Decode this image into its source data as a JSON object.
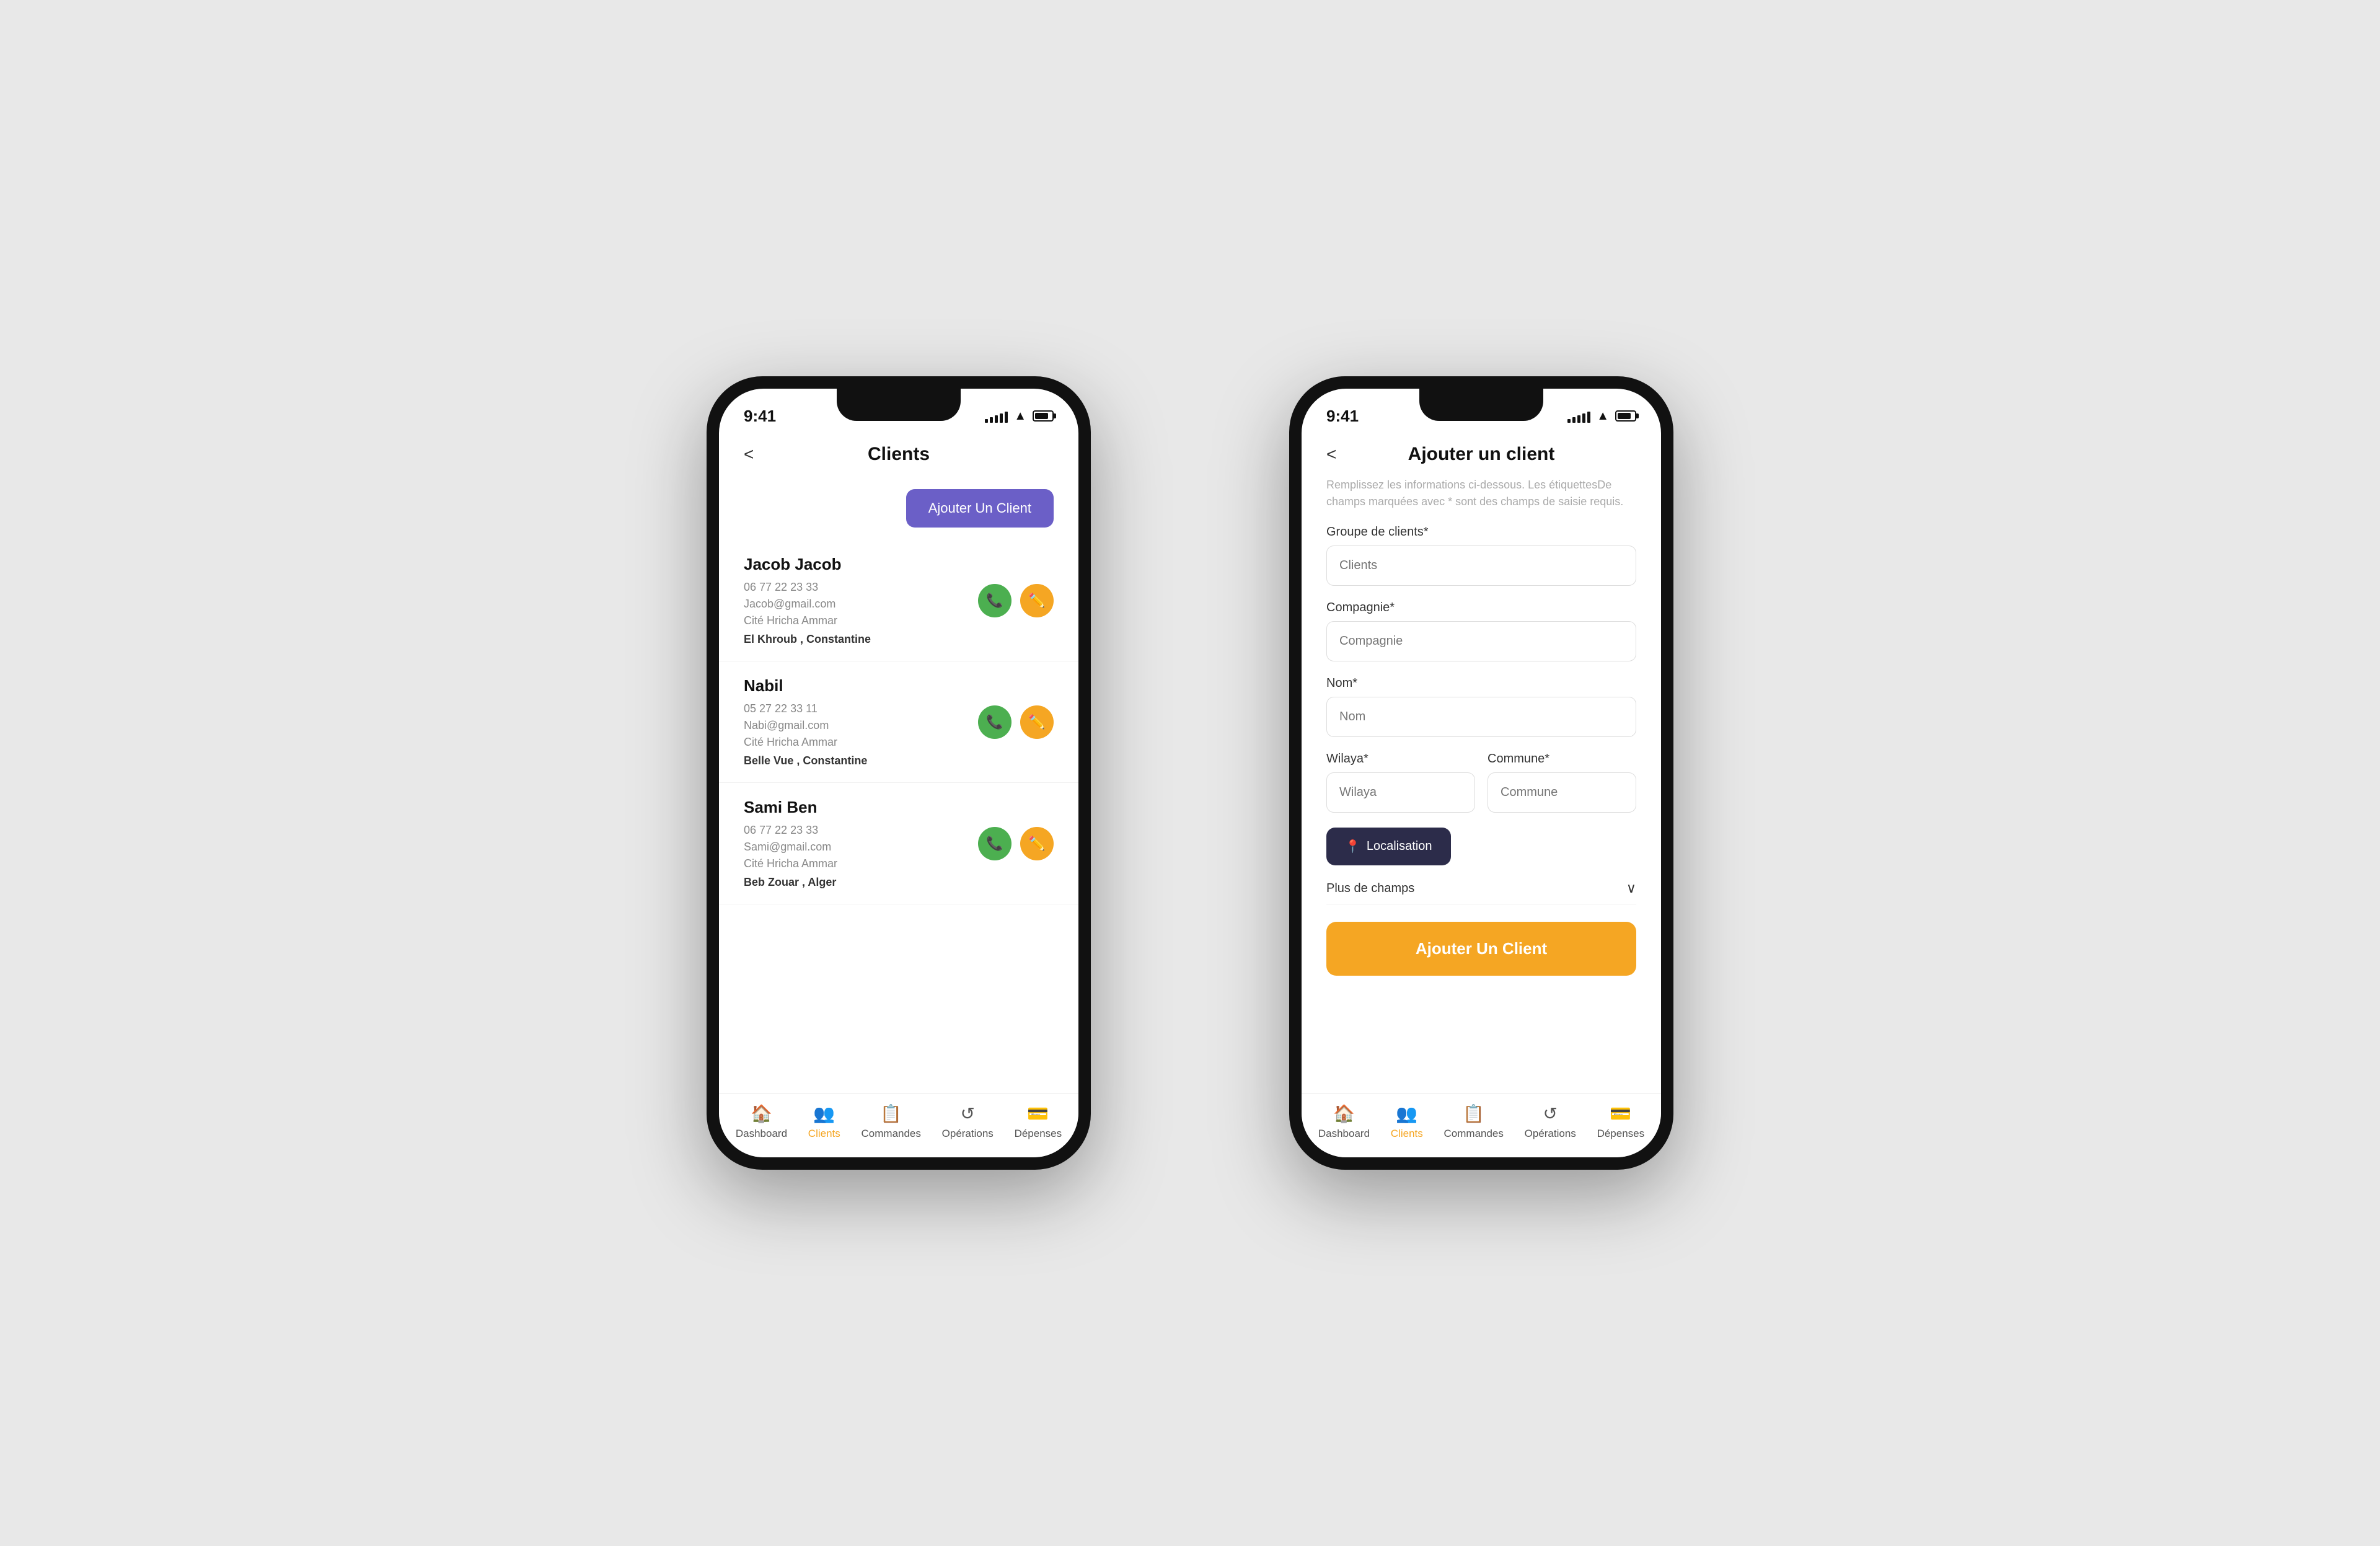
{
  "page": {
    "bg_color": "#e8e8e8"
  },
  "phone1": {
    "status": {
      "time": "9:41",
      "signal_bars": [
        6,
        9,
        12,
        15,
        18
      ],
      "wifi": "wifi",
      "battery": 80
    },
    "header": {
      "back_label": "<",
      "title": "Clients"
    },
    "add_button": "Ajouter Un Client",
    "clients": [
      {
        "name": "Jacob Jacob",
        "phone": "06 77 22 23 33",
        "email": "Jacob@gmail.com",
        "address": "Cité Hricha Ammar",
        "location": "El Khroub , Constantine"
      },
      {
        "name": "Nabil",
        "phone": "05 27 22 33 11",
        "email": "Nabi@gmail.com",
        "address": "Cité Hricha Ammar",
        "location": "Belle Vue , Constantine"
      },
      {
        "name": "Sami Ben",
        "phone": "06 77 22 23 33",
        "email": "Sami@gmail.com",
        "address": "Cité Hricha Ammar",
        "location": "Beb Zouar , Alger"
      }
    ],
    "nav": [
      {
        "icon": "🏠",
        "label": "Dashboard",
        "active": false
      },
      {
        "icon": "👥",
        "label": "Clients",
        "active": true
      },
      {
        "icon": "📋",
        "label": "Commandes",
        "active": false
      },
      {
        "icon": "↺",
        "label": "Opérations",
        "active": false
      },
      {
        "icon": "💳",
        "label": "Dépenses",
        "active": false
      }
    ]
  },
  "phone2": {
    "status": {
      "time": "9:41",
      "signal_bars": [
        6,
        9,
        12,
        15,
        18
      ],
      "wifi": "wifi",
      "battery": 80
    },
    "header": {
      "back_label": "<",
      "title": "Ajouter un client"
    },
    "subtitle": "Remplissez les informations ci-dessous. Les étiquettesDe champs marquées avec * sont des champs de saisie requis.",
    "fields": [
      {
        "label": "Groupe de clients*",
        "placeholder": "Clients"
      },
      {
        "label": "Compagnie*",
        "placeholder": "Compagnie"
      },
      {
        "label": "Nom*",
        "placeholder": "Nom"
      }
    ],
    "wilaya_label": "Wilaya*",
    "wilaya_placeholder": "Wilaya",
    "commune_label": "Commune*",
    "commune_placeholder": "Commune",
    "location_btn": "Localisation",
    "more_fields": "Plus de champs",
    "submit_btn": "Ajouter Un Client",
    "nav": [
      {
        "icon": "🏠",
        "label": "Dashboard",
        "active": false
      },
      {
        "icon": "👥",
        "label": "Clients",
        "active": true
      },
      {
        "icon": "📋",
        "label": "Commandes",
        "active": false
      },
      {
        "icon": "↺",
        "label": "Opérations",
        "active": false
      },
      {
        "icon": "💳",
        "label": "Dépenses",
        "active": false
      }
    ]
  }
}
